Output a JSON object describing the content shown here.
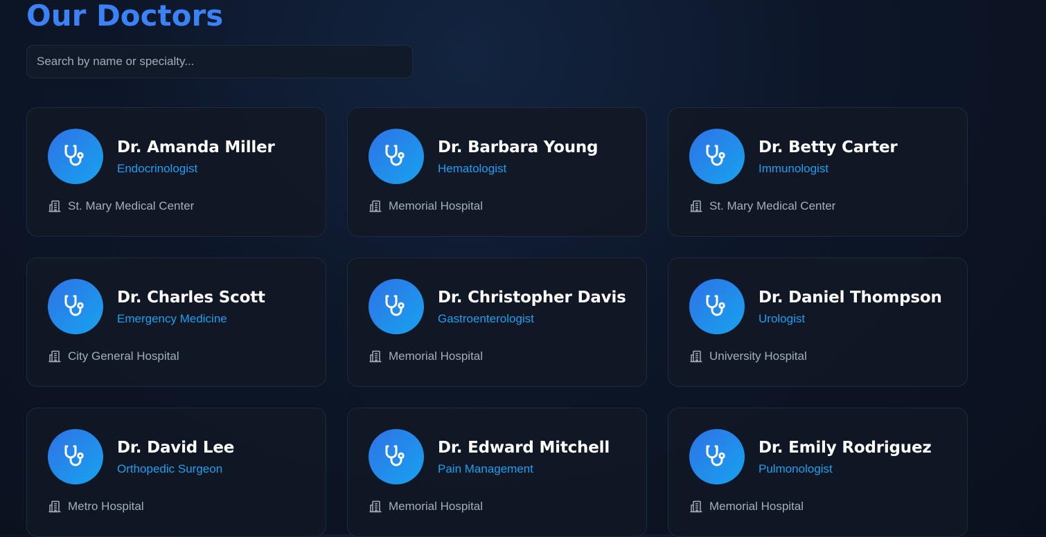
{
  "page": {
    "title": "Our Doctors",
    "search_placeholder": "Search by name or specialty..."
  },
  "colors": {
    "title": "#3b82f6",
    "specialty": "#1f9ff0",
    "avatar_start": "#2f72e6",
    "avatar_end": "#17a3ef"
  },
  "icons": {
    "avatar": "stethoscope-icon",
    "hospital": "hospital-building-icon"
  },
  "doctors": [
    {
      "name": "Dr. Amanda Miller",
      "specialty": "Endocrinologist",
      "hospital": "St. Mary Medical Center"
    },
    {
      "name": "Dr. Barbara Young",
      "specialty": "Hematologist",
      "hospital": "Memorial Hospital"
    },
    {
      "name": "Dr. Betty Carter",
      "specialty": "Immunologist",
      "hospital": "St. Mary Medical Center"
    },
    {
      "name": "Dr. Charles Scott",
      "specialty": "Emergency Medicine",
      "hospital": "City General Hospital"
    },
    {
      "name": "Dr. Christopher Davis",
      "specialty": "Gastroenterologist",
      "hospital": "Memorial Hospital"
    },
    {
      "name": "Dr. Daniel Thompson",
      "specialty": "Urologist",
      "hospital": "University Hospital"
    },
    {
      "name": "Dr. David Lee",
      "specialty": "Orthopedic Surgeon",
      "hospital": "Metro Hospital"
    },
    {
      "name": "Dr. Edward Mitchell",
      "specialty": "Pain Management",
      "hospital": "Memorial Hospital"
    },
    {
      "name": "Dr. Emily Rodriguez",
      "specialty": "Pulmonologist",
      "hospital": "Memorial Hospital"
    }
  ]
}
